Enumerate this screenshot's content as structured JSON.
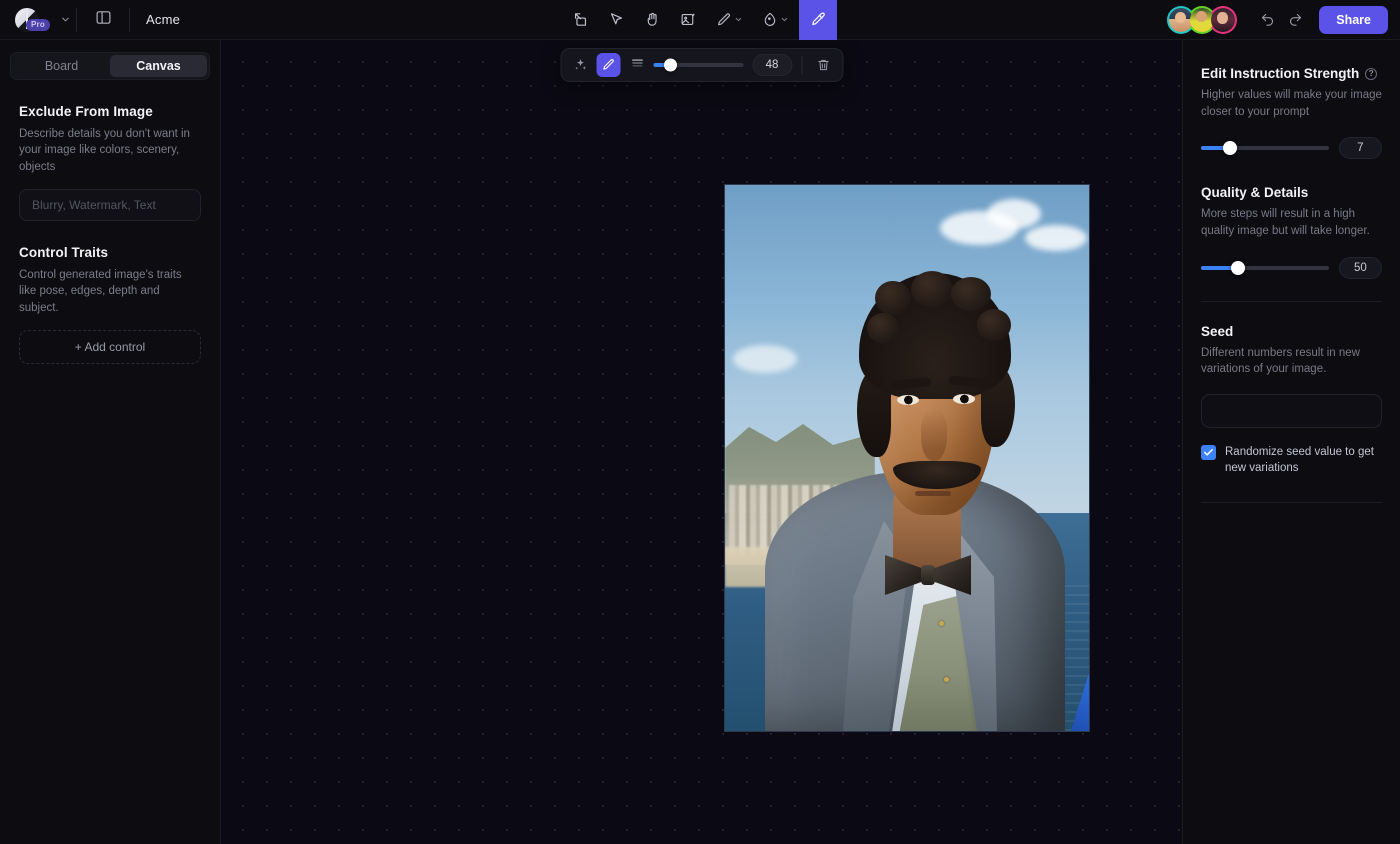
{
  "topbar": {
    "logo_badge": "Pro",
    "project_name": "Acme",
    "tools": [
      {
        "name": "export-icon",
        "label": "Export"
      },
      {
        "name": "select-icon",
        "label": "Select"
      },
      {
        "name": "hand-icon",
        "label": "Pan"
      },
      {
        "name": "add-image-icon",
        "label": "Add image"
      },
      {
        "name": "pencil-icon",
        "label": "Draw"
      },
      {
        "name": "eraser-icon",
        "label": "Erase"
      },
      {
        "name": "magic-edit-icon",
        "label": "Edit brush"
      }
    ],
    "undo_label": "Undo",
    "redo_label": "Redo",
    "share_label": "Share",
    "accent": "#5b53e8",
    "avatars": [
      {
        "name": "avatar-1",
        "ring": "#1fc7c7"
      },
      {
        "name": "avatar-2",
        "ring": "#63d321"
      },
      {
        "name": "avatar-3",
        "ring": "#e6337d"
      }
    ]
  },
  "sidebar": {
    "tabs": [
      {
        "label": "Board",
        "active": false
      },
      {
        "label": "Canvas",
        "active": true
      }
    ],
    "exclude": {
      "title": "Exclude From Image",
      "description": "Describe details you don't want in your image like colors, scenery, objects",
      "input_value": "",
      "input_placeholder": "Blurry, Watermark, Text"
    },
    "control_traits": {
      "title": "Control Traits",
      "description": "Control generated image's traits like pose, edges, depth and subject.",
      "add_label": "+  Add control"
    }
  },
  "canvas_toolbar": {
    "sparkle_icon": "sparkle-icon",
    "brush_icon": "brush-icon",
    "weight_icon": "line-weight-icon",
    "brush_size": "48",
    "brush_fill_pct": 19,
    "delete_icon": "trash-icon"
  },
  "canvas": {
    "image_alt": "Portrait of a mustachioed man in a grey suit and bow tie by the sea",
    "selection_handle": "resize-handle"
  },
  "right_panel": {
    "strength": {
      "title": "Edit Instruction Strength",
      "help": "?",
      "description": "Higher values will make your image closer to your prompt",
      "value": "7",
      "fill_pct": 23
    },
    "quality": {
      "title": "Quality & Details",
      "description": "More steps will result in a high quality image but will take longer.",
      "value": "50",
      "fill_pct": 29
    },
    "seed": {
      "title": "Seed",
      "description": "Different numbers result in new variations of your image.",
      "input_value": "",
      "input_placeholder": "",
      "checkbox_label": "Randomize seed value to get new variations",
      "checked": true,
      "checkbox_color": "#3b82f6"
    }
  }
}
